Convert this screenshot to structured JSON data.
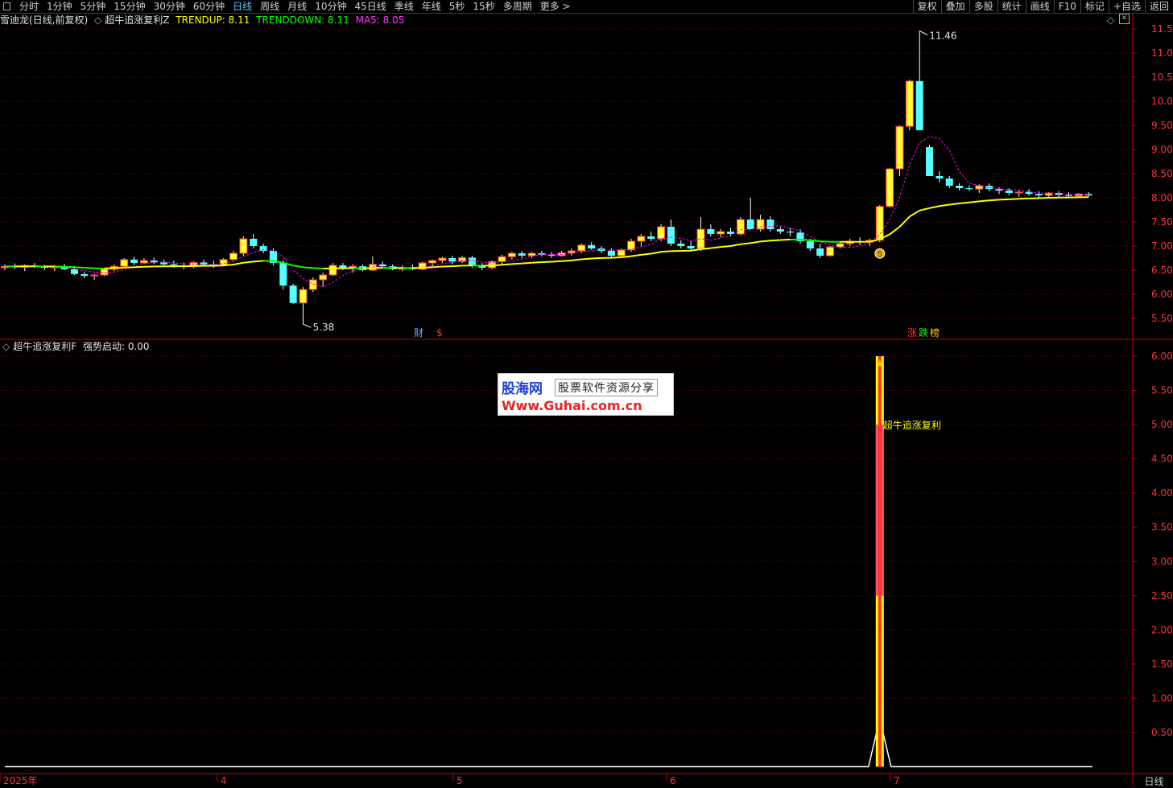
{
  "toolbar": {
    "periods": [
      "分时",
      "1分钟",
      "5分钟",
      "15分钟",
      "30分钟",
      "60分钟",
      "日线",
      "周线",
      "月线",
      "10分钟",
      "45日线",
      "季线",
      "年线",
      "5秒",
      "15秒",
      "多周期",
      "更多 >"
    ],
    "active_index": 6,
    "right_buttons": [
      "复权",
      "叠加",
      "多股",
      "统计",
      "画线",
      "F10",
      "标记",
      "+自选",
      "返回"
    ]
  },
  "main_legend": {
    "stock": "雪迪龙(日线,前复权)",
    "indicator": "超牛追涨复利Z",
    "trendup": "TRENDUP: 8.11",
    "trenddown": "TRENDDOWN: 8.11",
    "ma5": "MA5: 8.05"
  },
  "sub_legend": {
    "indicator": "超牛追涨复利F",
    "value": "强势启动: 0.00"
  },
  "annotations": {
    "high_label": "11.46",
    "low_label": "5.38",
    "cai": "财",
    "dollar": "$",
    "zhang": "涨",
    "die": "跌",
    "bang": "榜",
    "signal_text": "超牛追涨复利",
    "s_marker": "S"
  },
  "watermark": {
    "logo": "股海网",
    "sub": "股票软件资源分享",
    "url": "Www.Guhai.com.cn"
  },
  "period_label": "日线",
  "colors": {
    "up": "#ff3232",
    "down": "#54ffff",
    "yellow": "#ffff00",
    "green": "#00ff00",
    "magenta": "#ff00ff",
    "grid": "#8b0000",
    "axis": "#c80000"
  },
  "chart_data": [
    {
      "type": "candlestick",
      "title": "雪迪龙(日线,前复权)",
      "y_ticks": [
        5.5,
        6.0,
        6.5,
        7.0,
        7.5,
        8.0,
        8.5,
        9.0,
        9.5,
        10.0,
        10.5,
        11.0,
        11.5
      ],
      "ylim": [
        5.25,
        11.67
      ],
      "x_ticks": [
        "2025年",
        "4",
        "5",
        "6",
        "7"
      ],
      "series": [
        {
          "name": "TRENDUP",
          "last": 8.11
        },
        {
          "name": "TRENDDOWN",
          "last": 8.11
        },
        {
          "name": "MA5",
          "last": 8.05
        }
      ],
      "candles": [
        [
          6.55,
          6.62,
          6.5,
          6.58
        ],
        [
          6.58,
          6.64,
          6.52,
          6.56
        ],
        [
          6.56,
          6.62,
          6.48,
          6.6
        ],
        [
          6.6,
          6.65,
          6.55,
          6.57
        ],
        [
          6.57,
          6.61,
          6.5,
          6.55
        ],
        [
          6.55,
          6.6,
          6.48,
          6.58
        ],
        [
          6.58,
          6.63,
          6.5,
          6.52
        ],
        [
          6.52,
          6.58,
          6.4,
          6.42
        ],
        [
          6.42,
          6.46,
          6.33,
          6.38
        ],
        [
          6.38,
          6.42,
          6.3,
          6.4
        ],
        [
          6.4,
          6.55,
          6.38,
          6.52
        ],
        [
          6.52,
          6.62,
          6.48,
          6.58
        ],
        [
          6.58,
          6.75,
          6.55,
          6.72
        ],
        [
          6.72,
          6.78,
          6.6,
          6.65
        ],
        [
          6.65,
          6.75,
          6.62,
          6.7
        ],
        [
          6.7,
          6.76,
          6.62,
          6.66
        ],
        [
          6.66,
          6.72,
          6.58,
          6.62
        ],
        [
          6.62,
          6.7,
          6.55,
          6.6
        ],
        [
          6.6,
          6.66,
          6.52,
          6.58
        ],
        [
          6.58,
          6.68,
          6.54,
          6.66
        ],
        [
          6.66,
          6.72,
          6.6,
          6.62
        ],
        [
          6.62,
          6.7,
          6.55,
          6.6
        ],
        [
          6.6,
          6.75,
          6.58,
          6.72
        ],
        [
          6.72,
          6.9,
          6.68,
          6.85
        ],
        [
          6.85,
          7.2,
          6.8,
          7.15
        ],
        [
          7.15,
          7.25,
          6.95,
          7.0
        ],
        [
          7.0,
          7.05,
          6.85,
          6.9
        ],
        [
          6.9,
          6.95,
          6.6,
          6.65
        ],
        [
          6.65,
          6.7,
          6.1,
          6.18
        ],
        [
          6.18,
          6.22,
          5.8,
          5.82
        ],
        [
          5.82,
          6.15,
          5.38,
          6.1
        ],
        [
          6.1,
          6.35,
          6.05,
          6.3
        ],
        [
          6.3,
          6.45,
          6.15,
          6.4
        ],
        [
          6.4,
          6.65,
          6.38,
          6.6
        ],
        [
          6.6,
          6.65,
          6.5,
          6.55
        ],
        [
          6.55,
          6.62,
          6.45,
          6.58
        ],
        [
          6.58,
          6.62,
          6.48,
          6.5
        ],
        [
          6.5,
          6.78,
          6.48,
          6.62
        ],
        [
          6.62,
          6.68,
          6.55,
          6.58
        ],
        [
          6.58,
          6.62,
          6.5,
          6.52
        ],
        [
          6.52,
          6.6,
          6.48,
          6.55
        ],
        [
          6.55,
          6.62,
          6.5,
          6.52
        ],
        [
          6.52,
          6.68,
          6.5,
          6.65
        ],
        [
          6.65,
          6.72,
          6.58,
          6.7
        ],
        [
          6.7,
          6.78,
          6.65,
          6.75
        ],
        [
          6.75,
          6.8,
          6.62,
          6.68
        ],
        [
          6.68,
          6.8,
          6.65,
          6.76
        ],
        [
          6.76,
          6.8,
          6.55,
          6.6
        ],
        [
          6.6,
          6.65,
          6.5,
          6.55
        ],
        [
          6.55,
          6.7,
          6.52,
          6.68
        ],
        [
          6.68,
          6.82,
          6.62,
          6.78
        ],
        [
          6.78,
          6.88,
          6.72,
          6.85
        ],
        [
          6.85,
          6.9,
          6.75,
          6.8
        ],
        [
          6.8,
          6.88,
          6.75,
          6.85
        ],
        [
          6.85,
          6.9,
          6.78,
          6.82
        ],
        [
          6.82,
          6.88,
          6.75,
          6.8
        ],
        [
          6.8,
          6.9,
          6.78,
          6.86
        ],
        [
          6.86,
          6.95,
          6.8,
          6.9
        ],
        [
          6.9,
          7.05,
          6.85,
          7.02
        ],
        [
          7.02,
          7.08,
          6.92,
          6.95
        ],
        [
          6.95,
          7.0,
          6.85,
          6.9
        ],
        [
          6.9,
          6.95,
          6.75,
          6.8
        ],
        [
          6.8,
          6.95,
          6.78,
          6.92
        ],
        [
          6.92,
          7.15,
          6.88,
          7.1
        ],
        [
          7.1,
          7.25,
          7.0,
          7.2
        ],
        [
          7.2,
          7.3,
          7.1,
          7.15
        ],
        [
          7.15,
          7.45,
          7.1,
          7.4
        ],
        [
          7.4,
          7.55,
          7.0,
          7.05
        ],
        [
          7.05,
          7.12,
          6.95,
          7.0
        ],
        [
          7.0,
          7.1,
          6.9,
          6.95
        ],
        [
          6.95,
          7.6,
          6.9,
          7.35
        ],
        [
          7.35,
          7.45,
          7.2,
          7.25
        ],
        [
          7.25,
          7.35,
          7.18,
          7.3
        ],
        [
          7.3,
          7.38,
          7.2,
          7.25
        ],
        [
          7.25,
          7.6,
          7.22,
          7.55
        ],
        [
          7.55,
          8.0,
          7.5,
          7.35
        ],
        [
          7.35,
          7.65,
          7.3,
          7.55
        ],
        [
          7.55,
          7.62,
          7.3,
          7.35
        ],
        [
          7.35,
          7.4,
          7.25,
          7.3
        ],
        [
          7.3,
          7.38,
          7.2,
          7.28
        ],
        [
          7.28,
          7.35,
          7.05,
          7.1
        ],
        [
          7.1,
          7.15,
          6.9,
          6.95
        ],
        [
          6.95,
          7.05,
          6.75,
          6.8
        ],
        [
          6.8,
          7.0,
          6.78,
          6.98
        ],
        [
          6.98,
          7.1,
          6.95,
          7.05
        ],
        [
          7.05,
          7.15,
          7.0,
          7.1
        ],
        [
          7.1,
          7.18,
          7.02,
          7.08
        ],
        [
          7.08,
          7.15,
          7.0,
          7.12
        ],
        [
          7.12,
          7.85,
          7.08,
          7.82
        ],
        [
          7.82,
          8.62,
          7.8,
          8.6
        ],
        [
          8.6,
          9.5,
          8.45,
          9.48
        ],
        [
          9.48,
          10.45,
          9.4,
          10.42
        ],
        [
          10.42,
          11.46,
          9.4,
          9.4
        ],
        [
          9.05,
          9.1,
          8.45,
          8.45
        ],
        [
          8.45,
          8.55,
          8.32,
          8.4
        ],
        [
          8.4,
          8.45,
          8.2,
          8.25
        ],
        [
          8.25,
          8.3,
          8.15,
          8.2
        ],
        [
          8.2,
          8.26,
          8.14,
          8.18
        ],
        [
          8.18,
          8.28,
          8.1,
          8.25
        ],
        [
          8.25,
          8.3,
          8.14,
          8.18
        ],
        [
          8.18,
          8.22,
          8.08,
          8.15
        ],
        [
          8.15,
          8.2,
          8.05,
          8.1
        ],
        [
          8.1,
          8.16,
          8.02,
          8.12
        ],
        [
          8.12,
          8.18,
          8.04,
          8.08
        ],
        [
          8.08,
          8.14,
          8.0,
          8.05
        ],
        [
          8.05,
          8.12,
          8.0,
          8.1
        ],
        [
          8.1,
          8.14,
          8.02,
          8.06
        ],
        [
          8.06,
          8.12,
          8.0,
          8.04
        ],
        [
          8.04,
          8.1,
          8.0,
          8.08
        ],
        [
          8.08,
          8.12,
          8.02,
          8.05
        ]
      ]
    },
    {
      "type": "bar",
      "title": "超牛追涨复利F",
      "y_ticks": [
        0.5,
        1.0,
        1.5,
        2.0,
        2.5,
        3.0,
        3.5,
        4.0,
        4.5,
        5.0,
        5.5,
        6.0
      ],
      "ylim": [
        -0.03,
        6.05
      ],
      "signal_candle_index": 88,
      "signal_value": 6.0,
      "baseline": 0.0
    }
  ]
}
